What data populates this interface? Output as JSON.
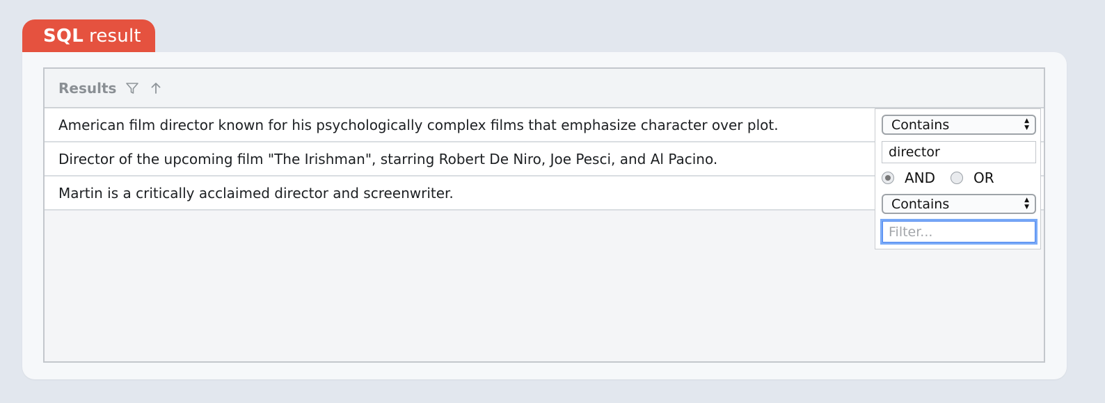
{
  "tab": {
    "bold": "SQL",
    "rest": "result"
  },
  "grid": {
    "header": "Results",
    "rows": [
      "American film director known for his psychologically complex films that emphasize character over plot.",
      "Director of the upcoming film \"The Irishman\", starring Robert De Niro, Joe Pesci, and Al Pacino.",
      "Martin is a critically acclaimed director and screenwriter."
    ]
  },
  "filter": {
    "condition1": "Contains",
    "value1": "director",
    "logic_and": "AND",
    "logic_or": "OR",
    "logic_selected": "AND",
    "condition2": "Contains",
    "value2_placeholder": "Filter..."
  },
  "icons": {
    "filter": "filter-icon",
    "sort": "arrow-up-icon"
  },
  "colors": {
    "tab": "#e5523f",
    "focus": "#7aaaf7"
  }
}
